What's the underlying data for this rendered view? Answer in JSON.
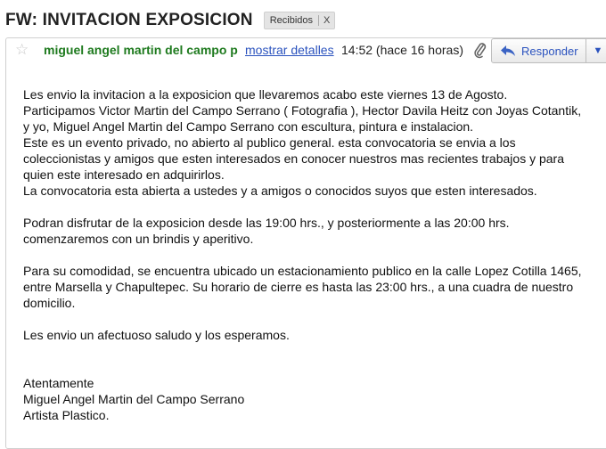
{
  "subject": "FW: INVITACION EXPOSICION",
  "label": {
    "name": "Recibidos",
    "remove": "X"
  },
  "header": {
    "sender": "miguel angel martin del campo p",
    "details_link": "mostrar detalles",
    "time": "14:52 (hace 16 horas)",
    "reply_label": "Responder",
    "icons": [
      "star-icon",
      "paperclip-icon",
      "reply-arrow-icon",
      "dropdown-arrow-icon"
    ]
  },
  "body": {
    "p1": [
      "Les envio la invitacion a la exposicion que llevaremos acabo este viernes 13 de Agosto.",
      "Participamos Victor Martin del Campo Serrano ( Fotografia ), Hector Davila Heitz con Joyas Cotantik,",
      "y yo, Miguel Angel Martin del Campo Serrano con escultura, pintura e instalacion.",
      "Este es un evento privado, no abierto al publico general. esta convocatoria se envia a los",
      "coleccionistas y amigos que esten interesados en conocer nuestros mas recientes trabajos y para",
      "quien este interesado en adquirirlos.",
      "La convocatoria esta abierta a ustedes y a amigos o conocidos suyos que esten interesados."
    ],
    "p2": [
      "Podran disfrutar de la exposicion desde las 19:00 hrs., y posteriormente a las 20:00 hrs.",
      "comenzaremos con un brindis y aperitivo."
    ],
    "p3": [
      "Para su comodidad, se encuentra ubicado un estacionamiento publico en la calle Lopez Cotilla 1465,",
      "entre Marsella y Chapultepec. Su horario de cierre es hasta las 23:00 hrs., a una cuadra de nuestro",
      "domicilio."
    ],
    "p4": "Les envio un afectuoso saludo y los esperamos.",
    "signature": [
      "Atentamente",
      "Miguel Angel Martin del Campo Serrano",
      "Artista Plastico."
    ]
  },
  "colors": {
    "sender": "#1e7a1e",
    "link": "#2a52be"
  }
}
